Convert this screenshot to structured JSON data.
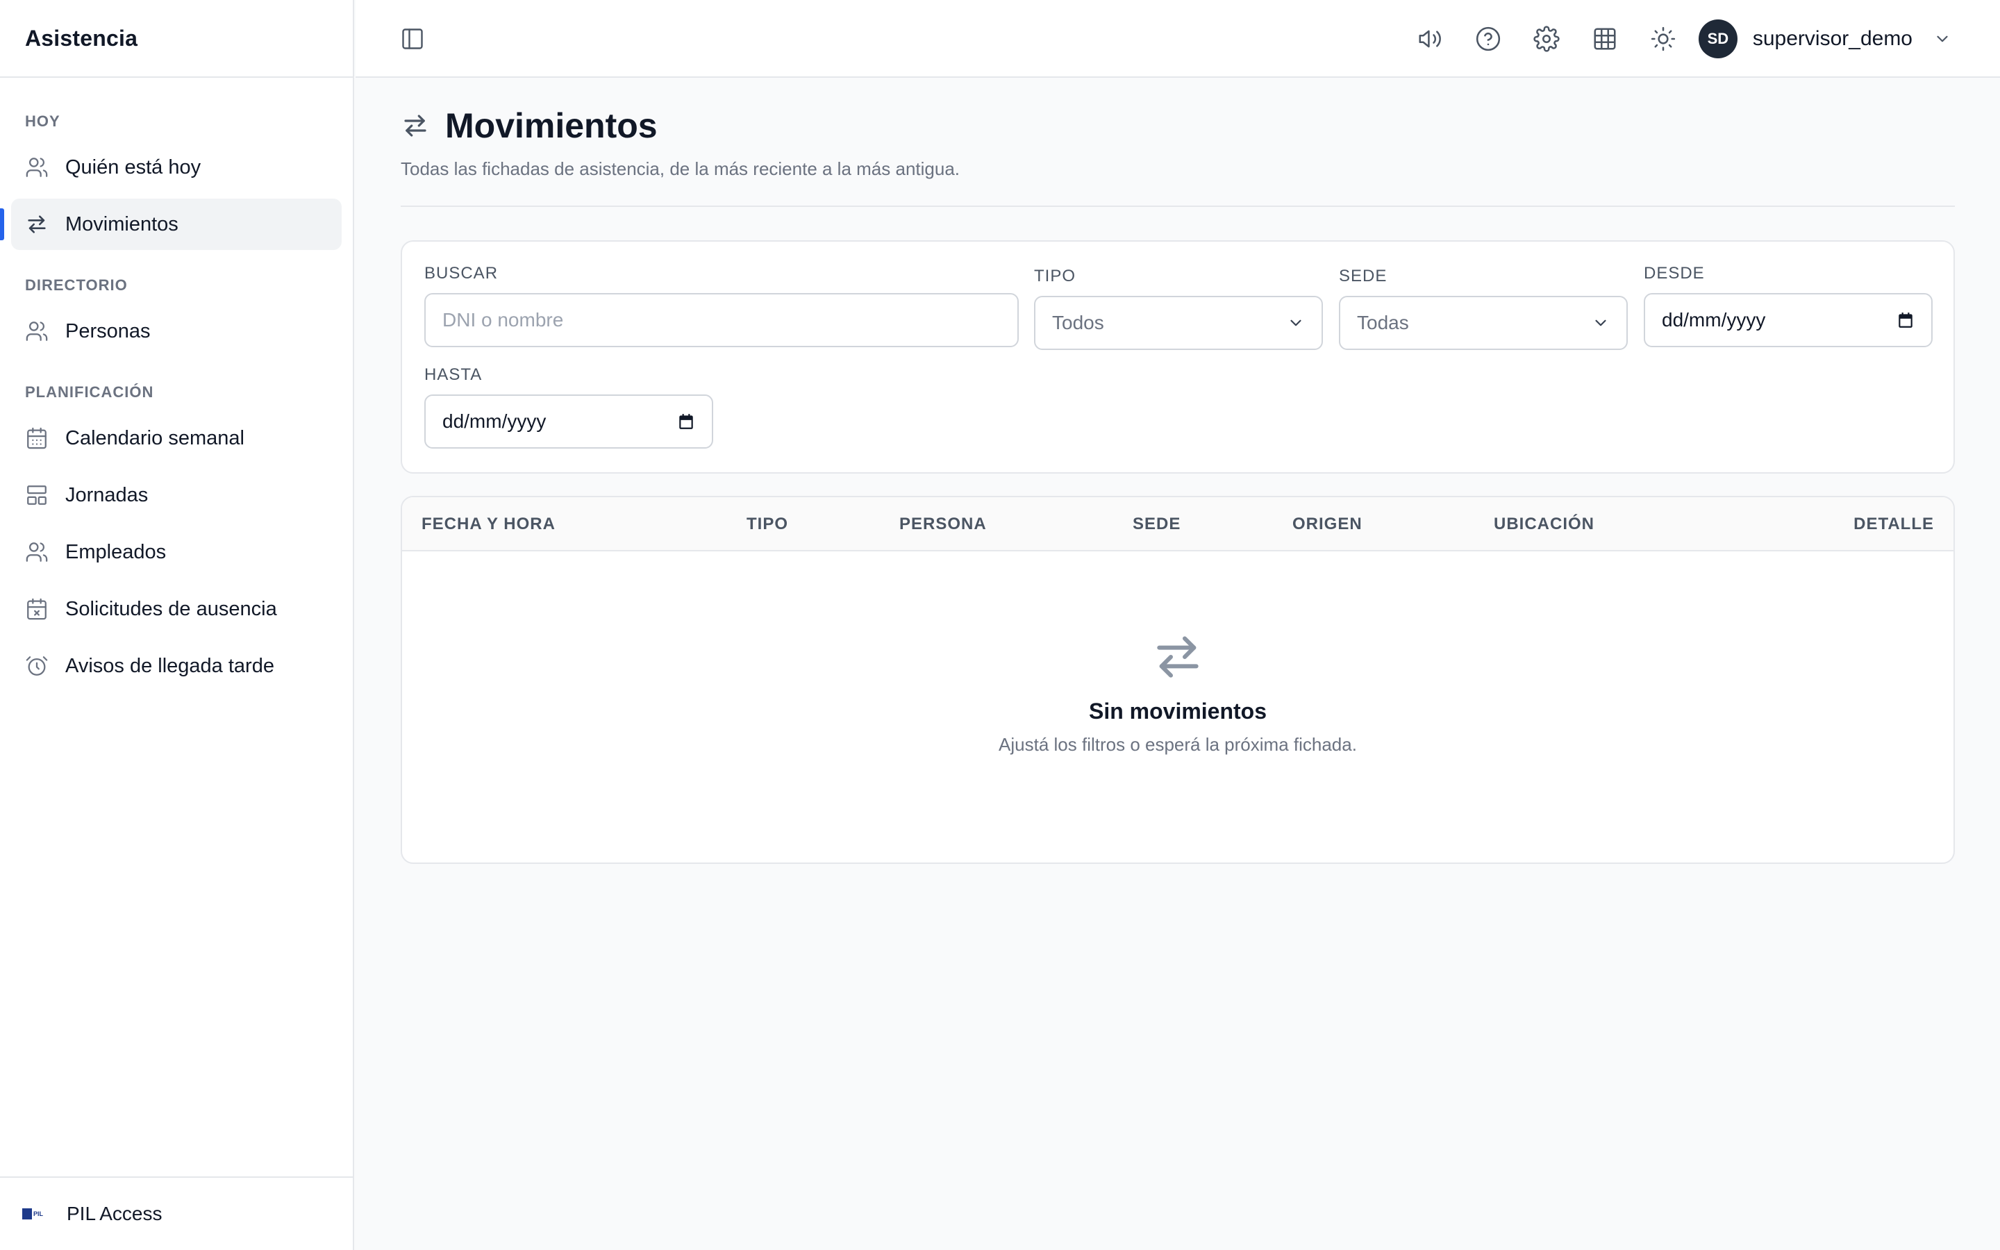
{
  "sidebar": {
    "title": "Asistencia",
    "sections": [
      {
        "heading": "HOY",
        "items": [
          {
            "label": "Quién está hoy",
            "icon": "users-icon"
          },
          {
            "label": "Movimientos",
            "icon": "arrows-swap-icon",
            "active": true
          }
        ]
      },
      {
        "heading": "DIRECTORIO",
        "items": [
          {
            "label": "Personas",
            "icon": "users-icon"
          }
        ]
      },
      {
        "heading": "PLANIFICACIÓN",
        "items": [
          {
            "label": "Calendario semanal",
            "icon": "calendar-icon"
          },
          {
            "label": "Jornadas",
            "icon": "layout-icon"
          },
          {
            "label": "Empleados",
            "icon": "users-icon"
          },
          {
            "label": "Solicitudes de ausencia",
            "icon": "calendar-x-icon"
          },
          {
            "label": "Avisos de llegada tarde",
            "icon": "alarm-clock-icon"
          }
        ]
      }
    ],
    "footer": {
      "label": "PIL Access",
      "logo_text": "PIL"
    }
  },
  "topbar": {
    "icons": [
      "volume-icon",
      "help-icon",
      "settings-icon",
      "grid-icon",
      "sun-icon"
    ],
    "user": {
      "initials": "SD",
      "name": "supervisor_demo"
    }
  },
  "page": {
    "title": "Movimientos",
    "subtitle": "Todas las fichadas de asistencia, de la más reciente a la más antigua."
  },
  "filters": {
    "search": {
      "label": "BUSCAR",
      "placeholder": "DNI o nombre",
      "value": ""
    },
    "tipo": {
      "label": "TIPO",
      "value": "Todos"
    },
    "sede": {
      "label": "SEDE",
      "value": "Todas"
    },
    "desde": {
      "label": "DESDE",
      "value": "dd/mm/yyyy"
    },
    "hasta": {
      "label": "HASTA",
      "value": "dd/mm/yyyy"
    }
  },
  "table": {
    "columns": [
      "FECHA Y HORA",
      "TIPO",
      "PERSONA",
      "SEDE",
      "ORIGEN",
      "UBICACIÓN",
      "DETALLE"
    ],
    "rows": [],
    "empty": {
      "title": "Sin movimientos",
      "text": "Ajustá los filtros o esperá la próxima fichada."
    }
  },
  "colors": {
    "accent": "#2563eb",
    "avatar_bg": "#1f2937",
    "active_bg": "#f1f3f5"
  }
}
